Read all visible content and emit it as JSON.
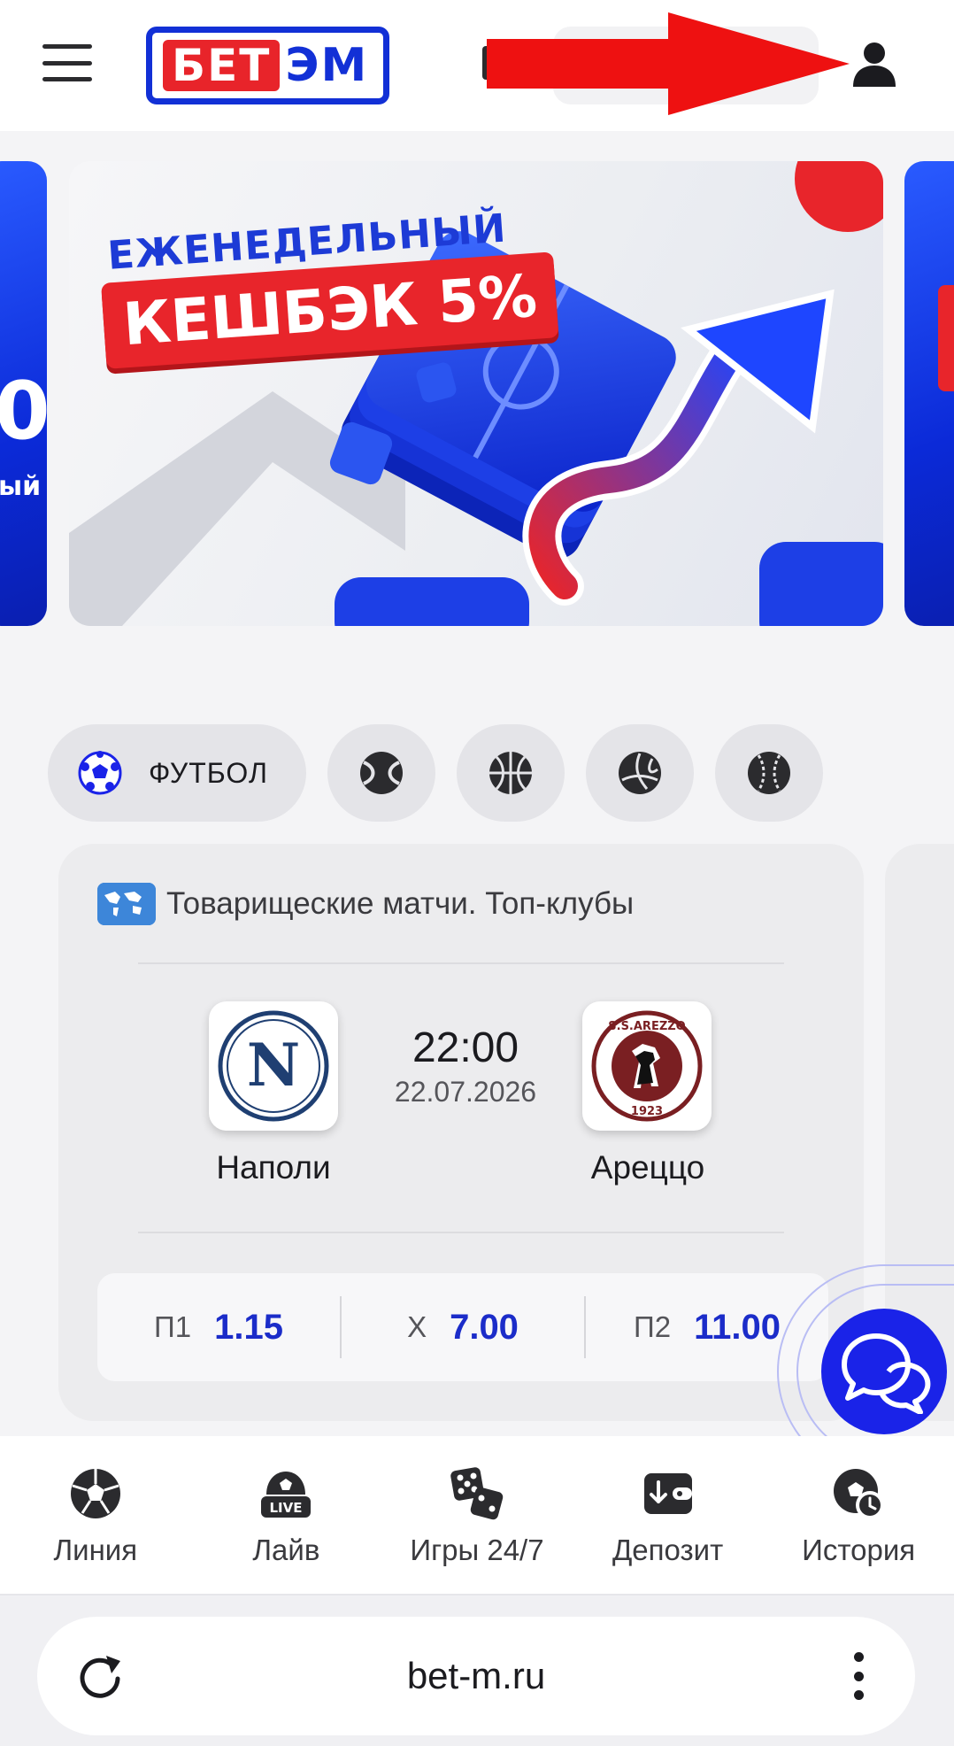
{
  "header": {
    "logo_left": "БЕТ",
    "logo_right": "ЭМ",
    "colors": {
      "brand_blue": "#1230d6",
      "brand_red": "#e8242a",
      "annotation_arrow": "#ee1111"
    }
  },
  "banner": {
    "headline": "ЕЖЕНЕДЕЛЬНЫЙ",
    "tag": "КЕШБЭК 5%",
    "left_peek_text": "0",
    "left_peek_sub": "ый"
  },
  "sports": {
    "active": {
      "label": "ФУТБОЛ",
      "icon": "soccer-ball-icon"
    },
    "others": [
      "tennis-ball-icon",
      "basketball-icon",
      "volleyball-icon",
      "baseball-icon"
    ]
  },
  "match": {
    "league": "Товарищеские матчи. Топ-клубы",
    "league_icon": "world-map-icon",
    "time": "22:00",
    "date": "22.07.2026",
    "home": {
      "name": "Наполи",
      "logo_letter": "N"
    },
    "away": {
      "name": "Ареццо",
      "logo_top": "S.S.AREZZO",
      "logo_year": "1923"
    },
    "odds": [
      {
        "key": "П1",
        "value": "1.15"
      },
      {
        "key": "Х",
        "value": "7.00"
      },
      {
        "key": "П2",
        "value": "11.00"
      }
    ]
  },
  "bottom_nav": [
    {
      "label": "Линия",
      "icon": "soccer-ball-icon"
    },
    {
      "label": "Лайв",
      "icon": "live-ball-icon"
    },
    {
      "label": "Игры 24/7",
      "icon": "dice-icon"
    },
    {
      "label": "Депозит",
      "icon": "deposit-wallet-icon"
    },
    {
      "label": "История",
      "icon": "history-ball-icon"
    }
  ],
  "browser": {
    "url": "bet-m.ru"
  }
}
